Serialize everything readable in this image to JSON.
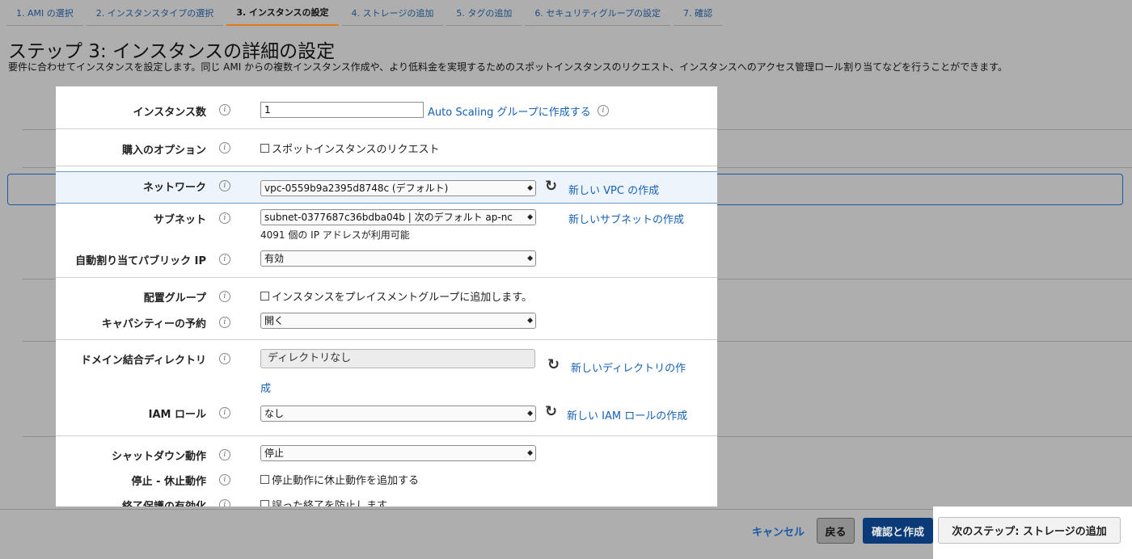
{
  "tabs": [
    {
      "label": "1. AMI の選択"
    },
    {
      "label": "2. インスタンスタイプの選択"
    },
    {
      "label": "3. インスタンスの設定"
    },
    {
      "label": "4. ストレージの追加"
    },
    {
      "label": "5. タグの追加"
    },
    {
      "label": "6. セキュリティグループの設定"
    },
    {
      "label": "7. 確認"
    }
  ],
  "active_tab": "3. インスタンスの設定",
  "page": {
    "title": "ステップ 3: インスタンスの詳細の設定",
    "description": "要件に合わせてインスタンスを設定します。同じ AMI からの複数インスタンス作成や、より低料金を実現するためのスポットインスタンスのリクエスト、インスタンスへのアクセス管理ロール割り当てなどを行うことができます。"
  },
  "form": {
    "info_glyph": "i",
    "select_arrow": "◆",
    "refresh_glyph": "↻",
    "instance_count": {
      "label": "インスタンス数",
      "value": "1",
      "link": "Auto Scaling グループに作成する"
    },
    "purchase_option": {
      "label": "購入のオプション",
      "checkbox": "スポットインスタンスのリクエスト"
    },
    "network": {
      "label": "ネットワーク",
      "value": "vpc-0559b9a2395d8748c (デフォルト)",
      "link": "新しい VPC の作成"
    },
    "subnet": {
      "label": "サブネット",
      "value": "subnet-0377687c36bdba04b | 次のデフォルト ap-nc",
      "hint": "4091 個の IP アドレスが利用可能",
      "link": "新しいサブネットの作成"
    },
    "public_ip": {
      "label": "自動割り当てパブリック IP",
      "value": "有効"
    },
    "placement_group": {
      "label": "配置グループ",
      "checkbox": "インスタンスをプレイスメントグループに追加します。"
    },
    "capacity_reservation": {
      "label": "キャパシティーの予約",
      "value": "開く"
    },
    "domain_directory": {
      "label": "ドメイン結合ディレクトリ",
      "value": "ディレクトリなし",
      "link_line1": "新しいディレクトリの作",
      "link_line2": "成"
    },
    "iam_role": {
      "label": "IAM ロール",
      "value": "なし",
      "link": "新しい IAM ロールの作成"
    },
    "shutdown_behavior": {
      "label": "シャットダウン動作",
      "value": "停止"
    },
    "stop_hibernate": {
      "label": "停止 - 休止動作",
      "checkbox": "停止動作に休止動作を追加する"
    },
    "termination_protection": {
      "label": "終了保護の有効化",
      "checkbox": "誤った終了を防止します"
    }
  },
  "footer": {
    "cancel": "キャンセル",
    "back": "戻る",
    "review_create": "確認と作成",
    "next_step": "次のステップ: ストレージの追加"
  }
}
